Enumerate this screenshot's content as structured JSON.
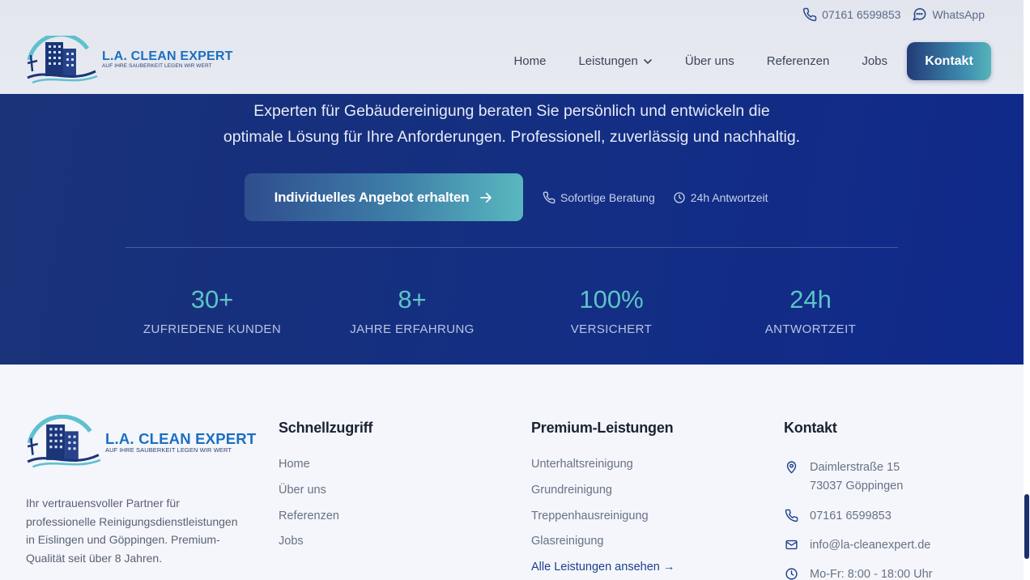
{
  "colors": {
    "brand_blue": "#1b6fc2",
    "hero_bg": "#132e84",
    "accent_teal": "#5cc4c6",
    "footer_bg": "#f4f6fb"
  },
  "topbar": {
    "phone": "07161 6599853",
    "whatsapp": "WhatsApp",
    "phone_icon": "phone-icon",
    "whatsapp_icon": "chat-bubble-icon"
  },
  "logo": {
    "title": "L.A. CLEAN EXPERT",
    "tagline": "AUF IHRE SAUBERKEIT LEGEN WIR WERT"
  },
  "nav": {
    "items": [
      {
        "label": "Home"
      },
      {
        "label": "Leistungen",
        "has_dropdown": true
      },
      {
        "label": "Über uns"
      },
      {
        "label": "Referenzen"
      },
      {
        "label": "Jobs"
      }
    ],
    "cta_label": "Kontakt"
  },
  "hero": {
    "line1": "Experten für Gebäudereinigung beraten Sie persönlich und entwickeln die",
    "line2": "optimale Lösung für Ihre Anforderungen. Professionell, zuverlässig und nachhaltig.",
    "cta_label": "Individuelles Angebot erhalten",
    "meta": [
      {
        "icon": "phone-icon",
        "label": "Sofortige Beratung"
      },
      {
        "icon": "clock-icon",
        "label": "24h Antwortzeit"
      }
    ],
    "stats": [
      {
        "value": "30+",
        "label": "ZUFRIEDENE KUNDEN"
      },
      {
        "value": "8+",
        "label": "JAHRE ERFAHRUNG"
      },
      {
        "value": "100%",
        "label": "VERSICHERT"
      },
      {
        "value": "24h",
        "label": "ANTWORTZEIT"
      }
    ]
  },
  "footer": {
    "description": "Ihr vertrauensvoller Partner für professionelle Reinigungsdienstleistungen in Eislingen und Göppingen. Premium-Qualität seit über 8 Jahren.",
    "quick": {
      "heading": "Schnellzugriff",
      "links": [
        "Home",
        "Über uns",
        "Referenzen",
        "Jobs"
      ]
    },
    "services": {
      "heading": "Premium-Leistungen",
      "links": [
        "Unterhaltsreinigung",
        "Grundreinigung",
        "Treppenhausreinigung",
        "Glasreinigung"
      ],
      "all_link": "Alle Leistungen ansehen →"
    },
    "contact": {
      "heading": "Kontakt",
      "street": "Daimlerstraße 15",
      "city": "73037 Göppingen",
      "phone": "07161 6599853",
      "email": "info@la-cleanexpert.de",
      "hours": "Mo-Fr: 8:00 - 18:00 Uhr"
    }
  }
}
